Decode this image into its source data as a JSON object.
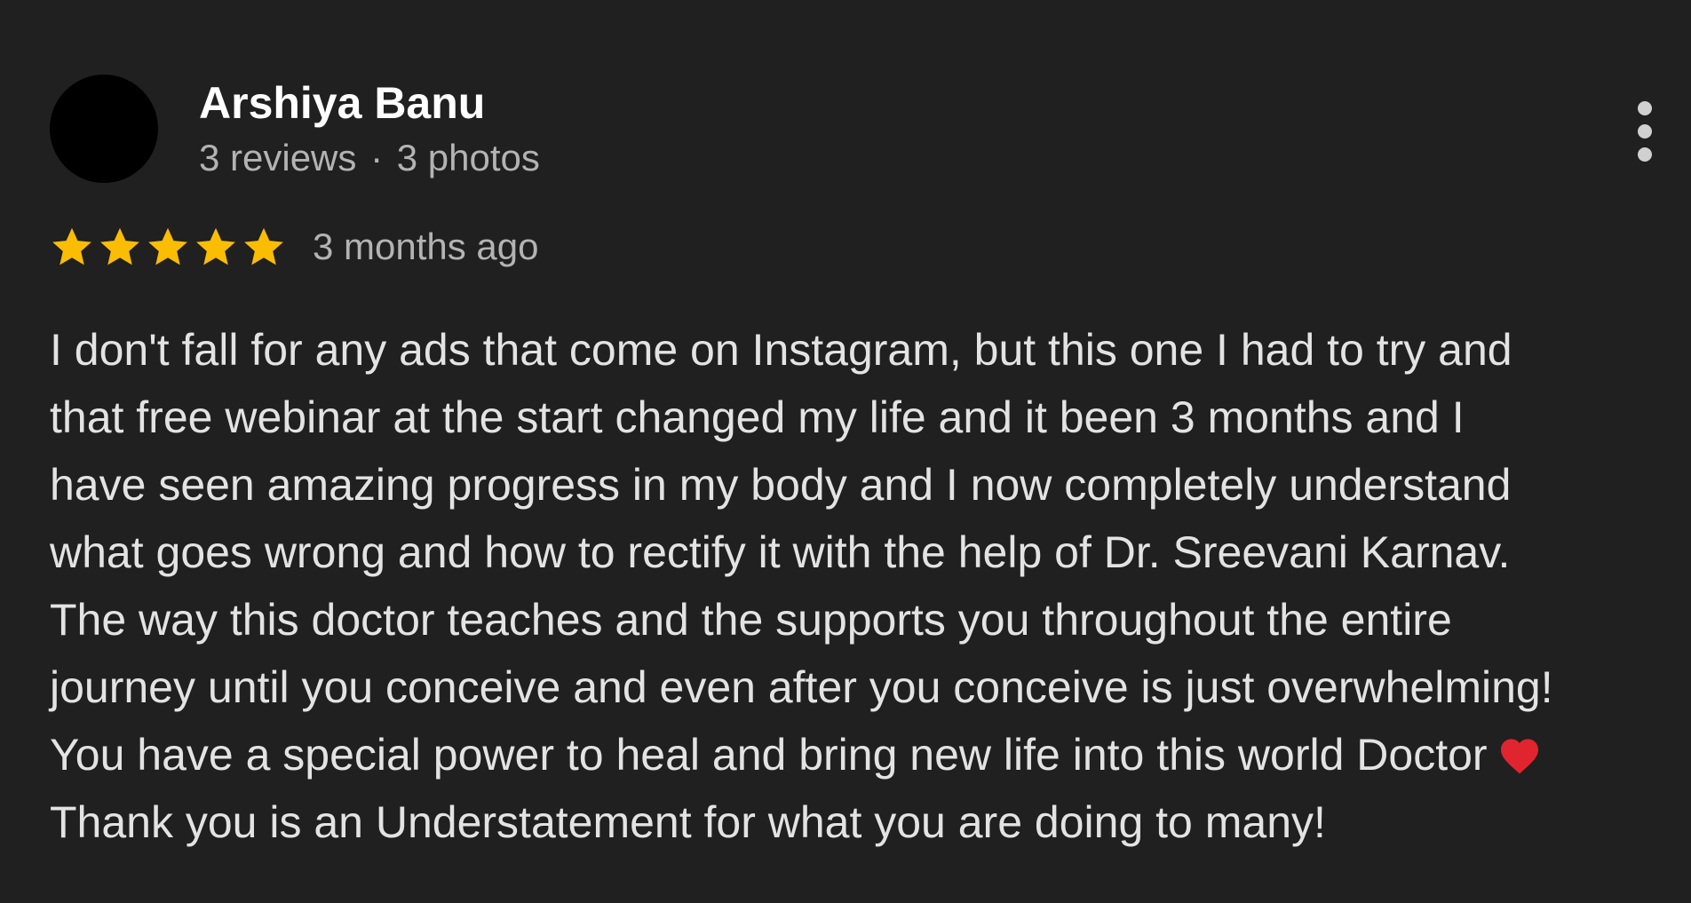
{
  "review": {
    "author": {
      "name": "Arshiya Banu",
      "reviews_count": "3 reviews",
      "separator": "·",
      "photos_count": "3 photos"
    },
    "rating": {
      "stars": 5,
      "max_stars": 5,
      "star_color": "#fbbc04"
    },
    "date": "3 months ago",
    "text_lines": [
      "I don't fall for any ads that come on Instagram, but this one I had to try and",
      "that free webinar at the start changed my life and it been 3 months and I",
      "have seen amazing progress in my body and I now completely understand",
      "what goes wrong and how to rectify it with the help of Dr. Sreevani Karnav.",
      "The way this doctor teaches and the supports you throughout the entire",
      "journey until you conceive and even after you conceive is just overwhelming!",
      "You have a special power to heal and bring new life into this world Doctor",
      "Thank you is an Understatement for what you are doing to many!"
    ],
    "emoji": "red-heart-emoji",
    "menu_icon": "more-vertical-icon"
  },
  "colors": {
    "background": "#202020",
    "name": "#ffffff",
    "meta": "#b3b3b3",
    "text": "#e3e3e3",
    "heart": "#e0252f"
  }
}
